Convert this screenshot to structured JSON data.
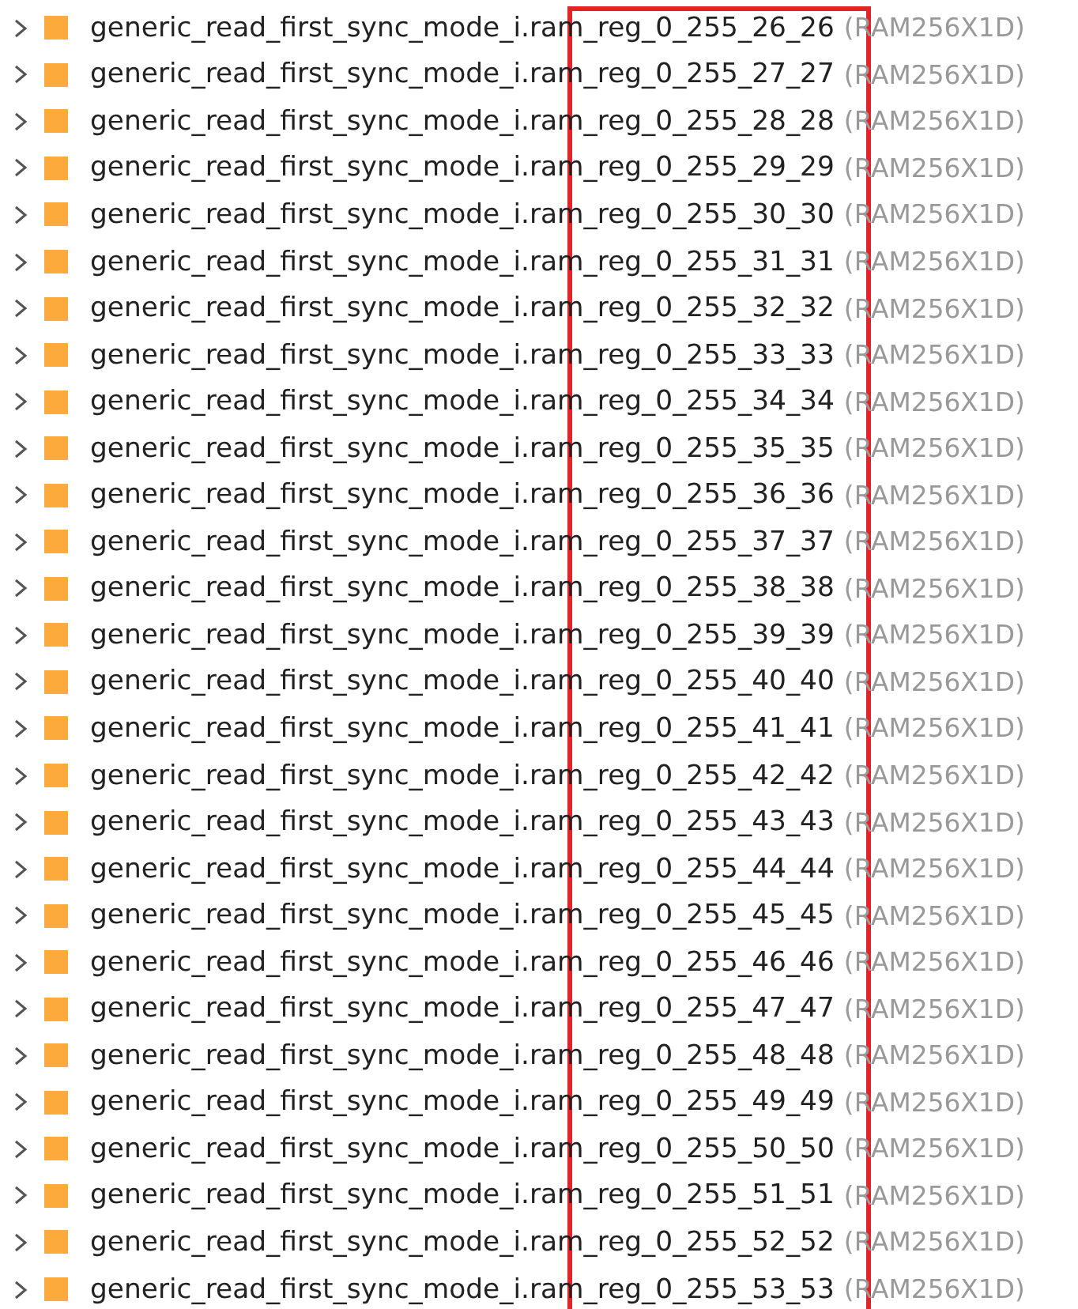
{
  "tree": {
    "items": [
      {
        "name": "generic_read_first_sync_mode_i.ram_reg_0_255_26_26",
        "type": "(RAM256X1D)",
        "expanded": false
      },
      {
        "name": "generic_read_first_sync_mode_i.ram_reg_0_255_27_27",
        "type": "(RAM256X1D)",
        "expanded": false
      },
      {
        "name": "generic_read_first_sync_mode_i.ram_reg_0_255_28_28",
        "type": "(RAM256X1D)",
        "expanded": false
      },
      {
        "name": "generic_read_first_sync_mode_i.ram_reg_0_255_29_29",
        "type": "(RAM256X1D)",
        "expanded": false
      },
      {
        "name": "generic_read_first_sync_mode_i.ram_reg_0_255_30_30",
        "type": "(RAM256X1D)",
        "expanded": false
      },
      {
        "name": "generic_read_first_sync_mode_i.ram_reg_0_255_31_31",
        "type": "(RAM256X1D)",
        "expanded": false
      },
      {
        "name": "generic_read_first_sync_mode_i.ram_reg_0_255_32_32",
        "type": "(RAM256X1D)",
        "expanded": false
      },
      {
        "name": "generic_read_first_sync_mode_i.ram_reg_0_255_33_33",
        "type": "(RAM256X1D)",
        "expanded": false
      },
      {
        "name": "generic_read_first_sync_mode_i.ram_reg_0_255_34_34",
        "type": "(RAM256X1D)",
        "expanded": false
      },
      {
        "name": "generic_read_first_sync_mode_i.ram_reg_0_255_35_35",
        "type": "(RAM256X1D)",
        "expanded": false
      },
      {
        "name": "generic_read_first_sync_mode_i.ram_reg_0_255_36_36",
        "type": "(RAM256X1D)",
        "expanded": false
      },
      {
        "name": "generic_read_first_sync_mode_i.ram_reg_0_255_37_37",
        "type": "(RAM256X1D)",
        "expanded": false
      },
      {
        "name": "generic_read_first_sync_mode_i.ram_reg_0_255_38_38",
        "type": "(RAM256X1D)",
        "expanded": false
      },
      {
        "name": "generic_read_first_sync_mode_i.ram_reg_0_255_39_39",
        "type": "(RAM256X1D)",
        "expanded": false
      },
      {
        "name": "generic_read_first_sync_mode_i.ram_reg_0_255_40_40",
        "type": "(RAM256X1D)",
        "expanded": false
      },
      {
        "name": "generic_read_first_sync_mode_i.ram_reg_0_255_41_41",
        "type": "(RAM256X1D)",
        "expanded": false
      },
      {
        "name": "generic_read_first_sync_mode_i.ram_reg_0_255_42_42",
        "type": "(RAM256X1D)",
        "expanded": false
      },
      {
        "name": "generic_read_first_sync_mode_i.ram_reg_0_255_43_43",
        "type": "(RAM256X1D)",
        "expanded": false
      },
      {
        "name": "generic_read_first_sync_mode_i.ram_reg_0_255_44_44",
        "type": "(RAM256X1D)",
        "expanded": false
      },
      {
        "name": "generic_read_first_sync_mode_i.ram_reg_0_255_45_45",
        "type": "(RAM256X1D)",
        "expanded": false
      },
      {
        "name": "generic_read_first_sync_mode_i.ram_reg_0_255_46_46",
        "type": "(RAM256X1D)",
        "expanded": false
      },
      {
        "name": "generic_read_first_sync_mode_i.ram_reg_0_255_47_47",
        "type": "(RAM256X1D)",
        "expanded": false
      },
      {
        "name": "generic_read_first_sync_mode_i.ram_reg_0_255_48_48",
        "type": "(RAM256X1D)",
        "expanded": false
      },
      {
        "name": "generic_read_first_sync_mode_i.ram_reg_0_255_49_49",
        "type": "(RAM256X1D)",
        "expanded": false
      },
      {
        "name": "generic_read_first_sync_mode_i.ram_reg_0_255_50_50",
        "type": "(RAM256X1D)",
        "expanded": false
      },
      {
        "name": "generic_read_first_sync_mode_i.ram_reg_0_255_51_51",
        "type": "(RAM256X1D)",
        "expanded": false
      },
      {
        "name": "generic_read_first_sync_mode_i.ram_reg_0_255_52_52",
        "type": "(RAM256X1D)",
        "expanded": false
      },
      {
        "name": "generic_read_first_sync_mode_i.ram_reg_0_255_53_53",
        "type": "(RAM256X1D)",
        "expanded": false
      }
    ]
  }
}
